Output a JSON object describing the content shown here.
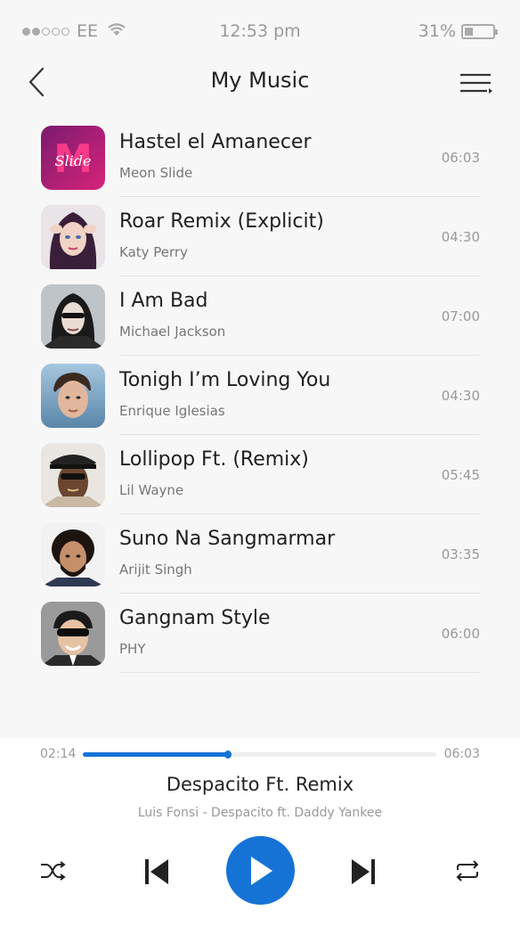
{
  "status_bar": {
    "carrier": "EE",
    "time": "12:53 pm",
    "battery": "31%",
    "battery_level": 0.31
  },
  "header": {
    "title": "My Music",
    "back_icon": "chevron-left-icon",
    "menu_icon": "menu-icon"
  },
  "tracks": [
    {
      "title": "Hastel el Amanecer",
      "artist": "Meon Slide",
      "duration": "06:03"
    },
    {
      "title": "Roar Remix (Explicit)",
      "artist": "Katy Perry",
      "duration": "04:30"
    },
    {
      "title": "I Am Bad",
      "artist": "Michael Jackson",
      "duration": "07:00"
    },
    {
      "title": "Tonigh I’m Loving You",
      "artist": "Enrique Iglesias",
      "duration": "04:30"
    },
    {
      "title": "Lollipop Ft. (Remix)",
      "artist": "Lil Wayne",
      "duration": "05:45"
    },
    {
      "title": "Suno Na Sangmarmar",
      "artist": "Arijit Singh",
      "duration": "03:35"
    },
    {
      "title": "Gangnam Style",
      "artist": "PHY",
      "duration": "06:00"
    }
  ],
  "player": {
    "elapsed": "02:14",
    "total": "06:03",
    "progress": 0.41,
    "title": "Despacito Ft. Remix",
    "artist": "Luis Fonsi - Despacito ft. Daddy Yankee",
    "accent_color": "#1673d6"
  }
}
